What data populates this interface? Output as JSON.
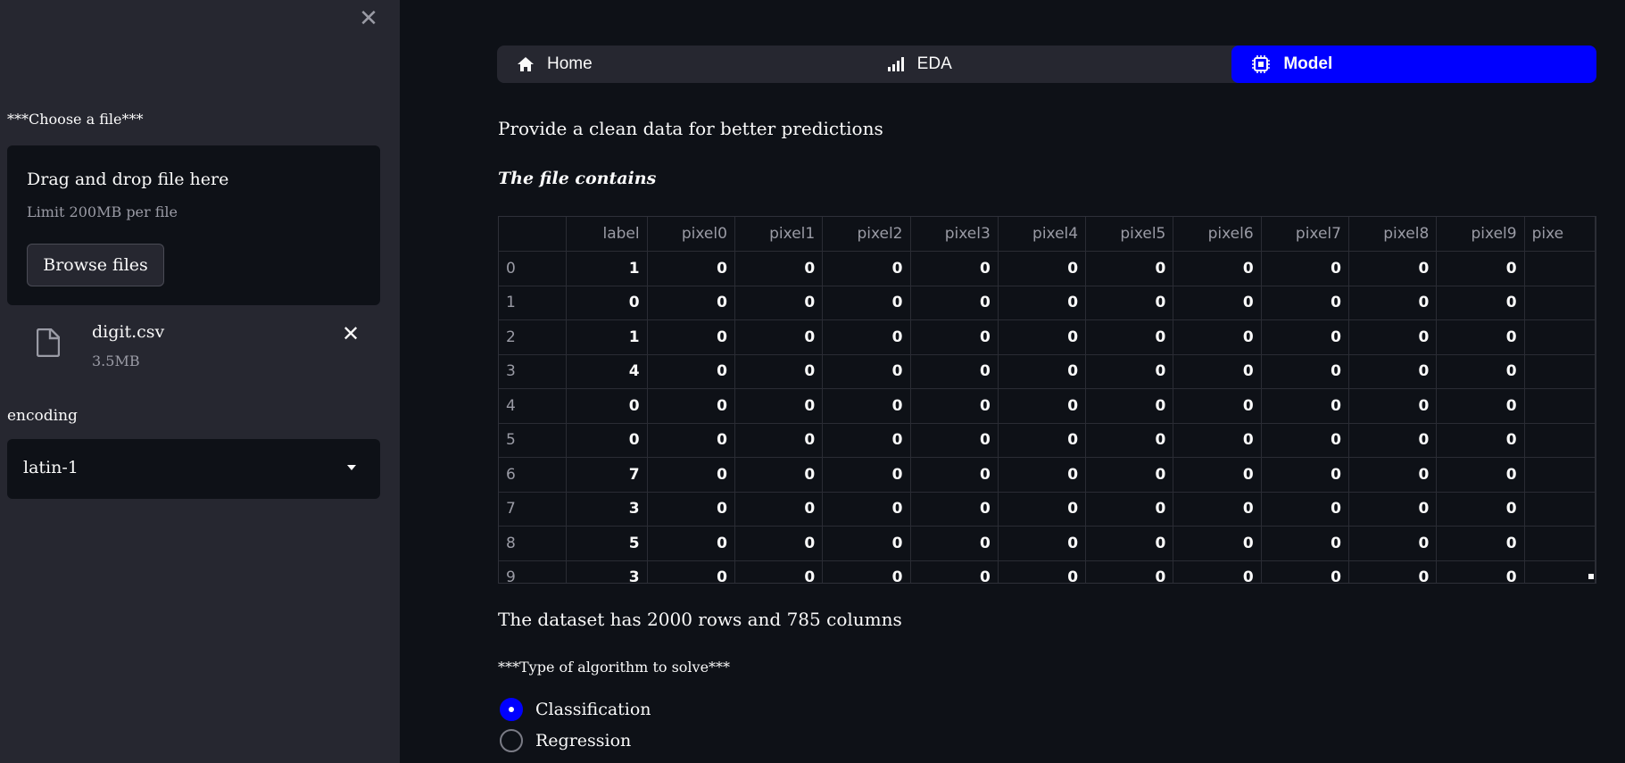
{
  "sidebar": {
    "close_label": "✕",
    "file_label": "***Choose a file***",
    "dropzone": {
      "title": "Drag and drop file here",
      "limit": "Limit 200MB per file",
      "browse_label": "Browse files"
    },
    "file": {
      "name": "digit.csv",
      "size": "3.5MB",
      "remove_label": "✕"
    },
    "encoding_label": "encoding",
    "encoding_value": "latin-1"
  },
  "nav": {
    "items": [
      {
        "label": "Home",
        "icon": "house-icon"
      },
      {
        "label": "EDA",
        "icon": "bar-chart-icon"
      },
      {
        "label": "Model",
        "icon": "cpu-icon"
      }
    ],
    "active": "Model",
    "active_color": "#0000ff"
  },
  "main": {
    "provide_text": "Provide a clean data for better predictions",
    "contains_text": "The file contains",
    "table": {
      "columns": [
        "label",
        "pixel0",
        "pixel1",
        "pixel2",
        "pixel3",
        "pixel4",
        "pixel5",
        "pixel6",
        "pixel7",
        "pixel8",
        "pixel9",
        "pixe"
      ],
      "rows": [
        {
          "index": "0",
          "cells": [
            "1",
            "0",
            "0",
            "0",
            "0",
            "0",
            "0",
            "0",
            "0",
            "0",
            "0",
            ""
          ]
        },
        {
          "index": "1",
          "cells": [
            "0",
            "0",
            "0",
            "0",
            "0",
            "0",
            "0",
            "0",
            "0",
            "0",
            "0",
            ""
          ]
        },
        {
          "index": "2",
          "cells": [
            "1",
            "0",
            "0",
            "0",
            "0",
            "0",
            "0",
            "0",
            "0",
            "0",
            "0",
            ""
          ]
        },
        {
          "index": "3",
          "cells": [
            "4",
            "0",
            "0",
            "0",
            "0",
            "0",
            "0",
            "0",
            "0",
            "0",
            "0",
            ""
          ]
        },
        {
          "index": "4",
          "cells": [
            "0",
            "0",
            "0",
            "0",
            "0",
            "0",
            "0",
            "0",
            "0",
            "0",
            "0",
            ""
          ]
        },
        {
          "index": "5",
          "cells": [
            "0",
            "0",
            "0",
            "0",
            "0",
            "0",
            "0",
            "0",
            "0",
            "0",
            "0",
            ""
          ]
        },
        {
          "index": "6",
          "cells": [
            "7",
            "0",
            "0",
            "0",
            "0",
            "0",
            "0",
            "0",
            "0",
            "0",
            "0",
            ""
          ]
        },
        {
          "index": "7",
          "cells": [
            "3",
            "0",
            "0",
            "0",
            "0",
            "0",
            "0",
            "0",
            "0",
            "0",
            "0",
            ""
          ]
        },
        {
          "index": "8",
          "cells": [
            "5",
            "0",
            "0",
            "0",
            "0",
            "0",
            "0",
            "0",
            "0",
            "0",
            "0",
            ""
          ]
        },
        {
          "index": "9",
          "cells": [
            "3",
            "0",
            "0",
            "0",
            "0",
            "0",
            "0",
            "0",
            "0",
            "0",
            "0",
            ""
          ]
        }
      ]
    },
    "dataset_text": "The dataset has 2000 rows and 785 columns",
    "algo_label": "***Type of algorithm to solve***",
    "algo_options": [
      {
        "label": "Classification",
        "checked": true
      },
      {
        "label": "Regression",
        "checked": false
      }
    ]
  }
}
